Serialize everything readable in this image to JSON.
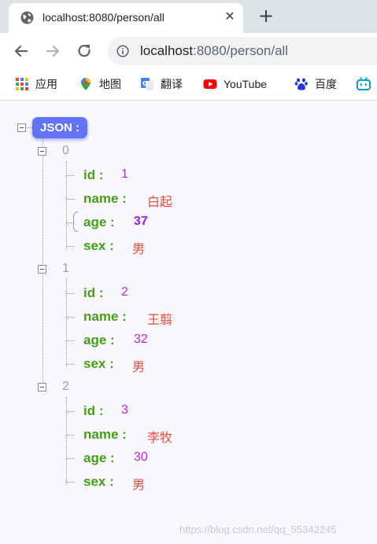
{
  "browser": {
    "tab_title": "localhost:8080/person/all",
    "url_host": "localhost",
    "url_rest": ":8080/person/all",
    "bookmarks": [
      {
        "label": "应用",
        "icon": "apps-grid-icon"
      },
      {
        "label": "地图",
        "icon": "maps-pin-icon"
      },
      {
        "label": "翻译",
        "icon": "translate-icon"
      },
      {
        "label": "YouTube",
        "icon": "youtube-icon"
      },
      {
        "label": "百度",
        "icon": "baidu-paw-icon"
      },
      {
        "label": "",
        "icon": "bilibili-icon"
      }
    ]
  },
  "json_viewer": {
    "root_label": "JSON :",
    "items": [
      {
        "index": "0",
        "fields": [
          {
            "key": "id :",
            "value": "1",
            "type": "number"
          },
          {
            "key": "name :",
            "value": "白起",
            "type": "string"
          },
          {
            "key": "age :",
            "value": "37",
            "type": "number",
            "highlighted": true
          },
          {
            "key": "sex :",
            "value": "男",
            "type": "string"
          }
        ]
      },
      {
        "index": "1",
        "fields": [
          {
            "key": "id :",
            "value": "2",
            "type": "number"
          },
          {
            "key": "name :",
            "value": "王翦",
            "type": "string"
          },
          {
            "key": "age :",
            "value": "32",
            "type": "number"
          },
          {
            "key": "sex :",
            "value": "男",
            "type": "string"
          }
        ]
      },
      {
        "index": "2",
        "fields": [
          {
            "key": "id :",
            "value": "3",
            "type": "number"
          },
          {
            "key": "name :",
            "value": "李牧",
            "type": "string"
          },
          {
            "key": "age :",
            "value": "30",
            "type": "number"
          },
          {
            "key": "sex :",
            "value": "男",
            "type": "string"
          }
        ]
      }
    ]
  },
  "watermark": "https://blog.csdn.net/qq_55342245",
  "colors": {
    "key": "#44a016",
    "number": "#bb22dd",
    "string": "#e74c3c",
    "root_badge": "#6274f5"
  }
}
